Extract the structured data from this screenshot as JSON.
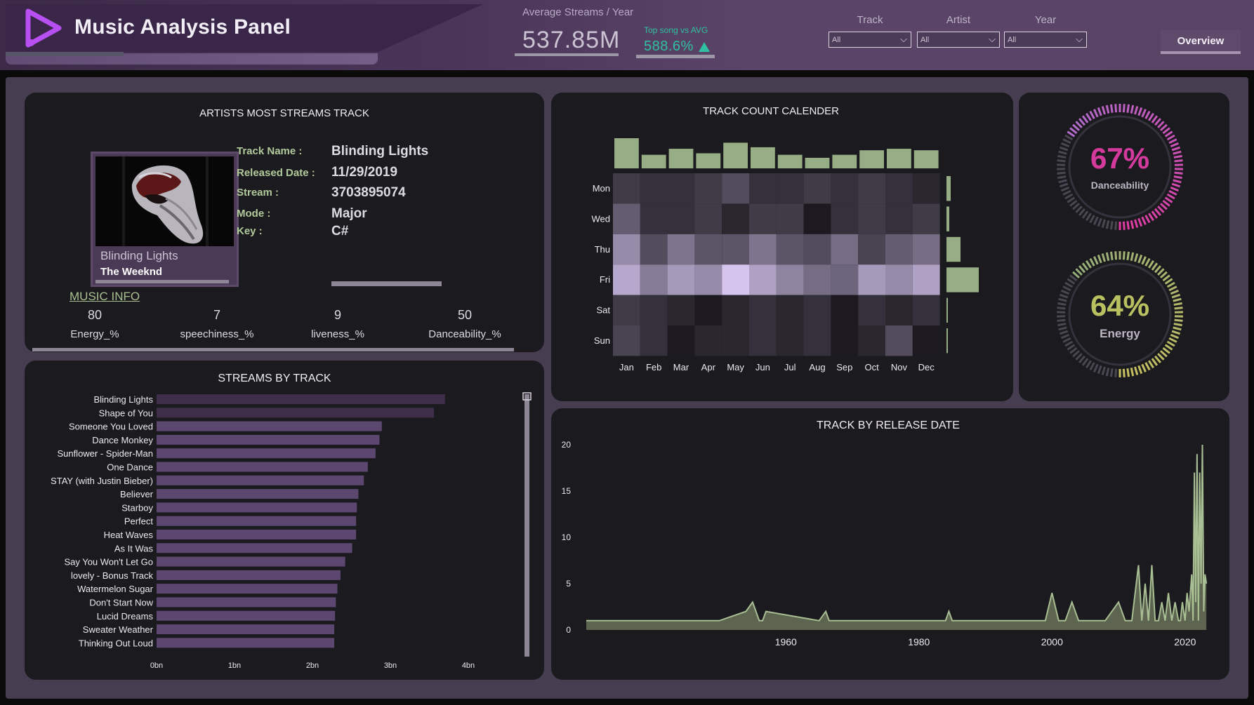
{
  "header": {
    "title": "Music Analysis Panel",
    "kpi_label": "Average Streams / Year",
    "kpi_value": "537.85M",
    "kpi_sub_label": "Top song vs AVG",
    "kpi_sub_value": "588.6%",
    "slicers": [
      {
        "label": "Track",
        "value": "All"
      },
      {
        "label": "Artist",
        "value": "All"
      },
      {
        "label": "Year",
        "value": "All"
      }
    ],
    "overview_label": "Overview"
  },
  "artist_card": {
    "title": "ARTISTS MOST STREAMS TRACK",
    "album_song": "Blinding Lights",
    "album_artist": "The Weeknd",
    "track_name_label": "Track Name :",
    "track_name": "Blinding Lights",
    "released_label": "Released Date :",
    "released": "11/29/2019",
    "stream_label": "Stream :",
    "stream": "3703895074",
    "mode_label": "Mode :",
    "mode": "Major",
    "key_label": "Key :",
    "key": "C#",
    "music_info": "MUSIC INFO",
    "metrics": [
      {
        "value": "80",
        "label": "Energy_%"
      },
      {
        "value": "7",
        "label": "speechiness_%"
      },
      {
        "value": "9",
        "label": "liveness_%"
      },
      {
        "value": "50",
        "label": "Danceability_%"
      }
    ]
  },
  "chart_data": [
    {
      "type": "bar",
      "orientation": "horizontal",
      "title": "STREAMS BY TRACK",
      "categories": [
        "Blinding Lights",
        "Shape of You",
        "Someone You Loved",
        "Dance Monkey",
        "Sunflower - Spider-Man",
        "One Dance",
        "STAY (with Justin Bieber)",
        "Believer",
        "Starboy",
        "Perfect",
        "Heat Waves",
        "As It Was",
        "Say You Won't Let Go",
        "lovely - Bonus Track",
        "Watermelon Sugar",
        "Don't Start Now",
        "Lucid Dreams",
        "Sweater Weather",
        "Thinking Out Loud"
      ],
      "values": [
        3.7,
        3.56,
        2.89,
        2.86,
        2.81,
        2.71,
        2.66,
        2.59,
        2.57,
        2.56,
        2.56,
        2.51,
        2.42,
        2.36,
        2.32,
        2.3,
        2.29,
        2.28,
        2.28
      ],
      "xticks": [
        "0bn",
        "1bn",
        "2bn",
        "3bn",
        "4bn"
      ],
      "xlim": [
        0,
        4
      ],
      "colors": {
        "top": "#3e2e4a",
        "rest": "#5c4770"
      }
    },
    {
      "type": "heatmap",
      "title": "TRACK COUNT CALENDER",
      "rows": [
        "Mon",
        "Wed",
        "Thu",
        "Fri",
        "Sat",
        "Sun"
      ],
      "columns": [
        "Jan",
        "Feb",
        "Mar",
        "Apr",
        "May",
        "Jun",
        "Jul",
        "Aug",
        "Sep",
        "Oct",
        "Nov",
        "Dec"
      ],
      "values": [
        [
          3,
          2,
          2,
          3,
          5,
          2,
          2,
          3,
          2,
          3,
          2,
          1
        ],
        [
          7,
          2,
          2,
          3,
          1,
          3,
          3,
          0,
          2,
          3,
          2,
          3
        ],
        [
          13,
          5,
          10,
          6,
          6,
          10,
          6,
          5,
          9,
          4,
          7,
          9
        ],
        [
          17,
          11,
          15,
          13,
          21,
          16,
          12,
          9,
          8,
          15,
          13,
          16
        ],
        [
          3,
          2,
          1,
          0,
          1,
          2,
          1,
          2,
          0,
          2,
          1,
          2
        ],
        [
          4,
          2,
          0,
          1,
          1,
          2,
          1,
          2,
          0,
          1,
          5,
          0
        ]
      ],
      "column_totals": [
        20,
        9,
        13,
        10,
        17,
        14,
        9,
        7,
        9,
        12,
        13,
        12
      ],
      "row_totals": [
        3,
        2,
        10,
        23,
        1,
        1
      ],
      "colors": {
        "bars": "#97ad86",
        "low": "#1c1a20",
        "high": "#d4c4ee"
      }
    },
    {
      "type": "area",
      "title": "TRACK BY RELEASE DATE",
      "x": [
        1930,
        1950,
        1954,
        1955,
        1956,
        1956.5,
        1957,
        1965,
        1966,
        1966.5,
        1967,
        1984,
        1984.5,
        1985,
        1999,
        2000,
        2001,
        2002,
        2003,
        2004,
        2005,
        2006,
        2007,
        2008,
        2009,
        2010,
        2011,
        2012,
        2013,
        2013.5,
        2014,
        2014.5,
        2015,
        2015.5,
        2016,
        2016.5,
        2017,
        2017.5,
        2018,
        2018.5,
        2019,
        2019.3,
        2019.6,
        2020,
        2020.3,
        2020.6,
        2021,
        2021.2,
        2021.4,
        2021.6,
        2021.8,
        2022,
        2022.2,
        2022.4,
        2022.6,
        2022.8,
        2023,
        2023.2
      ],
      "y": [
        1,
        1,
        2,
        3,
        1,
        1,
        2,
        1,
        2,
        1,
        1,
        1,
        2,
        1,
        1,
        4,
        1,
        1,
        3,
        1,
        1,
        1,
        1,
        1,
        2,
        3,
        1,
        1,
        7,
        1,
        5,
        1,
        7,
        1,
        1,
        3,
        1,
        4,
        1,
        3,
        1,
        1,
        3,
        1,
        4,
        2,
        6,
        1,
        17,
        3,
        19,
        1,
        17,
        5,
        20,
        2,
        6,
        5
      ],
      "yticks": [
        0,
        5,
        10,
        15,
        20
      ],
      "xticks": [
        1960,
        1980,
        2000,
        2020
      ],
      "xlim": [
        1930,
        2023.5
      ],
      "ylim": [
        0,
        20
      ],
      "colors": {
        "fill": "#5d6450",
        "line": "#a8be93"
      }
    }
  ],
  "gauges": [
    {
      "value": "67%",
      "percent": 67,
      "label": "Danceability",
      "color_start": "#e03aa0",
      "color_end": "#b16ecf"
    },
    {
      "value": "64%",
      "percent": 64,
      "label": "Energy",
      "color_start": "#c7c060",
      "color_end": "#94ae7a"
    }
  ]
}
